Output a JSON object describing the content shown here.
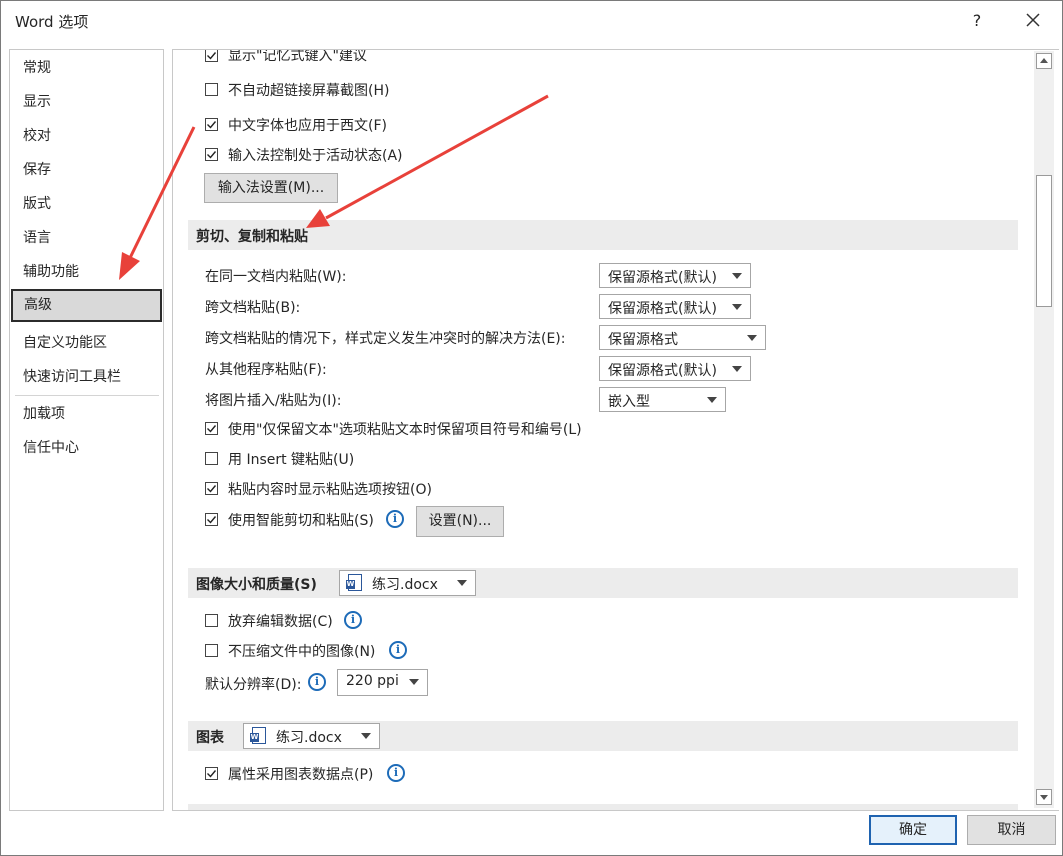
{
  "window": {
    "title": "Word 选项",
    "help": "?"
  },
  "nav": {
    "items": [
      "常规",
      "显示",
      "校对",
      "保存",
      "版式",
      "语言",
      "辅助功能",
      "高级",
      "自定义功能区",
      "快速访问工具栏",
      "加载项",
      "信任中心"
    ],
    "selected": "高级"
  },
  "editing": {
    "opt_memory": "显示\"记忆式键入\"建议",
    "opt_no_autolink": "不自动超链接屏幕截图(H)",
    "opt_cn_font_west": "中文字体也应用于西文(F)",
    "opt_ime_active": "输入法控制处于活动状态(A)",
    "ime_settings_button": "输入法设置(M)..."
  },
  "paste": {
    "section_title": "剪切、复制和粘贴",
    "rows": [
      {
        "label": "在同一文档内粘贴(W):",
        "value": "保留源格式(默认)"
      },
      {
        "label": "跨文档粘贴(B):",
        "value": "保留源格式(默认)"
      },
      {
        "label": "跨文档粘贴的情况下，样式定义发生冲突时的解决方法(E):",
        "value": "保留源格式"
      },
      {
        "label": "从其他程序粘贴(F):",
        "value": "保留源格式(默认)"
      },
      {
        "label": "将图片插入/粘贴为(I):",
        "value": "嵌入型"
      }
    ],
    "opt_keep_text_only": "使用\"仅保留文本\"选项粘贴文本时保留项目符号和编号(L)",
    "opt_insert_key": "用 Insert 键粘贴(U)",
    "opt_show_paste_btn": "粘贴内容时显示粘贴选项按钮(O)",
    "opt_smart_cut": "使用智能剪切和粘贴(S)",
    "settings_button": "设置(N)..."
  },
  "image": {
    "section_title": "图像大小和质量(S)",
    "doc": "练习.docx",
    "opt_discard_edit": "放弃编辑数据(C)",
    "opt_no_compress": "不压缩文件中的图像(N)",
    "resolution_label": "默认分辨率(D):",
    "resolution_value": "220 ppi"
  },
  "chart": {
    "section_title": "图表",
    "doc": "练习.docx",
    "opt_follow_point": "属性采用图表数据点(P)"
  },
  "footer": {
    "ok": "确定",
    "cancel": "取消"
  },
  "colors": {
    "arrow": "#e8413a",
    "accent": "#1f63b0",
    "info": "#1d6bb8"
  }
}
